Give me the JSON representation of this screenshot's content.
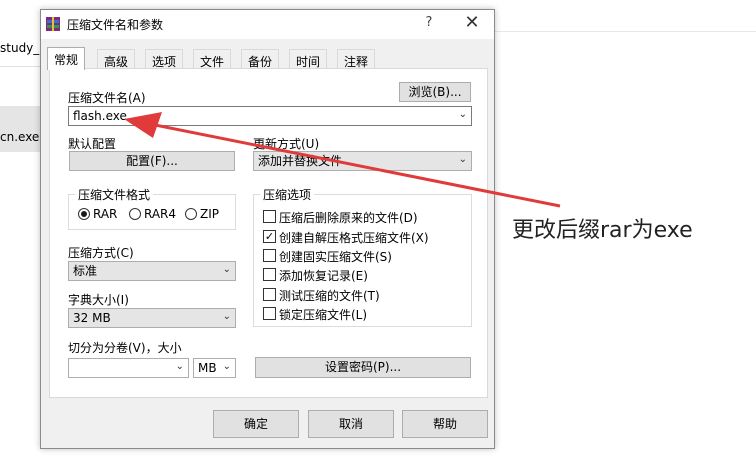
{
  "background": {
    "item1": "study_p",
    "item2": "cn.exe"
  },
  "dialog": {
    "title": "压缩文件名和参数",
    "help_glyph": "?",
    "close_glyph": "✕",
    "tabs": [
      "常规",
      "高级",
      "选项",
      "文件",
      "备份",
      "时间",
      "注释"
    ],
    "archive_name_label": "压缩文件名(A)",
    "browse_button": "浏览(B)...",
    "archive_name_value": "flash.exe",
    "default_profile_label": "默认配置",
    "profiles_button": "配置(F)...",
    "update_mode_label": "更新方式(U)",
    "update_mode_value": "添加并替换文件",
    "format_group": {
      "title": "压缩文件格式",
      "options": [
        "RAR",
        "RAR4",
        "ZIP"
      ],
      "selected": "RAR"
    },
    "method_label": "压缩方式(C)",
    "method_value": "标准",
    "dict_label": "字典大小(I)",
    "dict_value": "32 MB",
    "split_label": "切分为分卷(V)，大小",
    "split_value": "",
    "split_unit": "MB",
    "options_group": {
      "title": "压缩选项",
      "items": [
        {
          "label": "压缩后删除原来的文件(D)",
          "checked": false
        },
        {
          "label": "创建自解压格式压缩文件(X)",
          "checked": true
        },
        {
          "label": "创建固实压缩文件(S)",
          "checked": false
        },
        {
          "label": "添加恢复记录(E)",
          "checked": false
        },
        {
          "label": "测试压缩的文件(T)",
          "checked": false
        },
        {
          "label": "锁定压缩文件(L)",
          "checked": false
        }
      ]
    },
    "password_button": "设置密码(P)...",
    "ok_button": "确定",
    "cancel_button": "取消",
    "help_button": "帮助"
  },
  "annotation_text": "更改后缀rar为exe",
  "colors": {
    "arrow": "#e03a3a",
    "dialog_bg": "#f0f0f0"
  }
}
